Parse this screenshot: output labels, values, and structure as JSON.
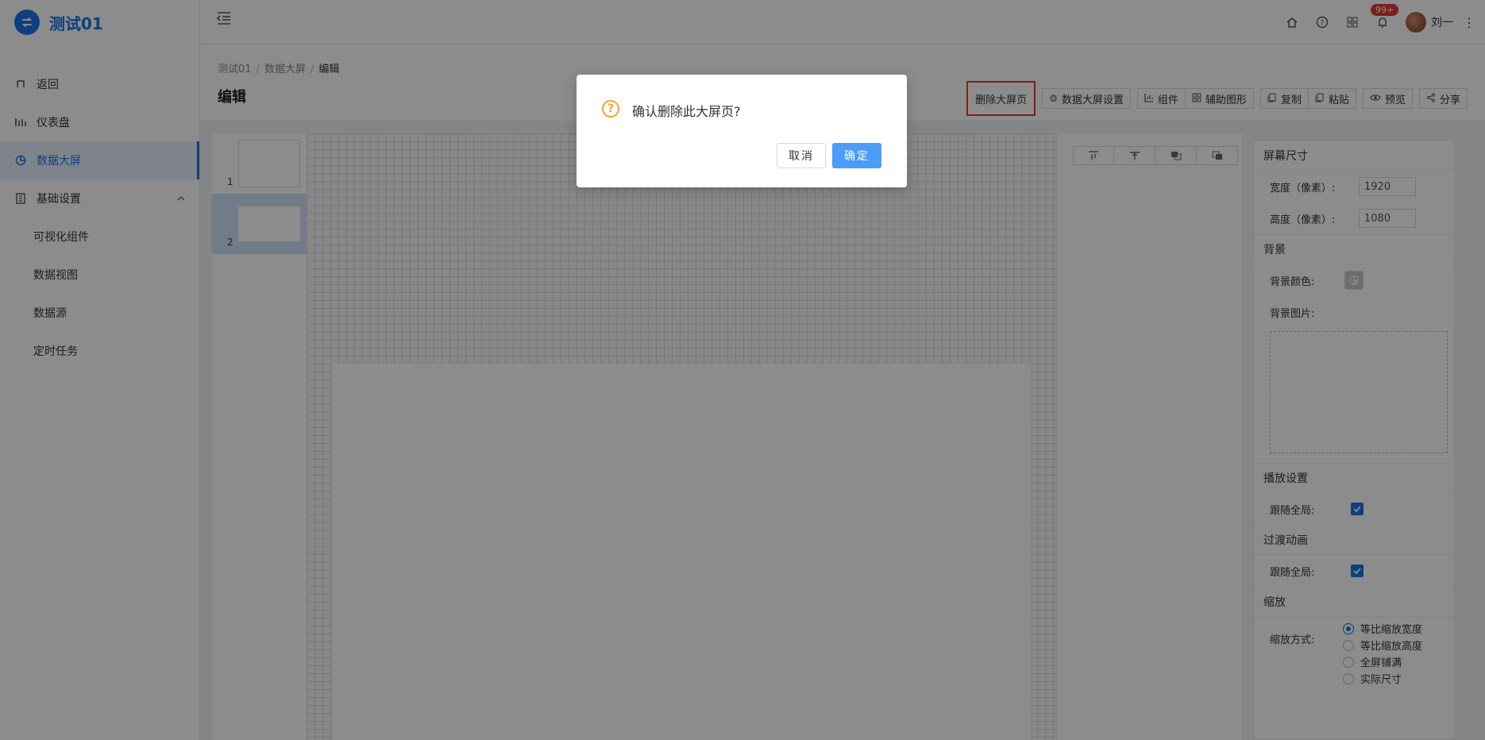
{
  "app": {
    "title": "测试01"
  },
  "sidebar": {
    "items": [
      {
        "label": "返回"
      },
      {
        "label": "仪表盘"
      },
      {
        "label": "数据大屏"
      },
      {
        "label": "基础设置"
      }
    ],
    "sub_items": [
      {
        "label": "可视化组件"
      },
      {
        "label": "数据视图"
      },
      {
        "label": "数据源"
      },
      {
        "label": "定时任务"
      }
    ]
  },
  "topbar": {
    "notification_badge": "99+",
    "username": "刘一"
  },
  "breadcrumb": [
    "测试01",
    "数据大屏",
    "编辑"
  ],
  "page": {
    "title": "编辑"
  },
  "toolbar": {
    "delete_page": "删除大屏页",
    "settings": "数据大屏设置",
    "component": "组件",
    "aux_shape": "辅助图形",
    "copy": "复制",
    "paste": "粘贴",
    "preview": "预览",
    "share": "分享"
  },
  "pages": [
    {
      "num": "1"
    },
    {
      "num": "2"
    }
  ],
  "props": {
    "screen_size": "屏幕尺寸",
    "width_label": "宽度（像素）:",
    "width_value": "1920",
    "height_label": "高度（像素）:",
    "height_value": "1080",
    "background": "背景",
    "bg_color_label": "背景颜色:",
    "bg_image_label": "背景图片:",
    "playback": "播放设置",
    "follow_global_1": "跟随全局:",
    "transition": "过渡动画",
    "follow_global_2": "跟随全局:",
    "zoom": "缩放",
    "zoom_mode_label": "缩放方式:",
    "zoom_options": [
      "等比缩放宽度",
      "等比缩放高度",
      "全屏铺满",
      "实际尺寸"
    ]
  },
  "dialog": {
    "message": "确认删除此大屏页?",
    "cancel": "取消",
    "confirm": "确定"
  },
  "colors": {
    "accent": "#1a73e8",
    "warning": "#f5a623",
    "highlight": "#e53935"
  }
}
